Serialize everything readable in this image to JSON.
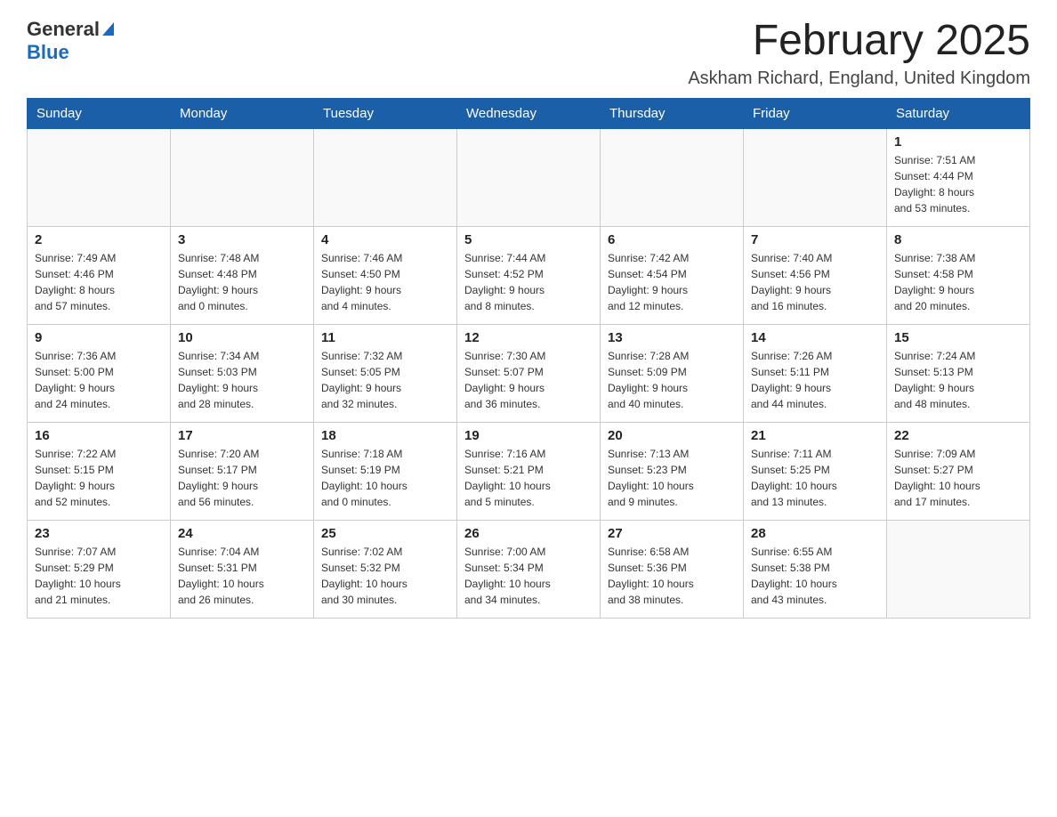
{
  "header": {
    "logo": {
      "text_general": "General",
      "text_blue": "Blue",
      "alt": "GeneralBlue Logo"
    },
    "title": "February 2025",
    "subtitle": "Askham Richard, England, United Kingdom"
  },
  "days_of_week": [
    "Sunday",
    "Monday",
    "Tuesday",
    "Wednesday",
    "Thursday",
    "Friday",
    "Saturday"
  ],
  "weeks": [
    [
      {
        "day": "",
        "info": ""
      },
      {
        "day": "",
        "info": ""
      },
      {
        "day": "",
        "info": ""
      },
      {
        "day": "",
        "info": ""
      },
      {
        "day": "",
        "info": ""
      },
      {
        "day": "",
        "info": ""
      },
      {
        "day": "1",
        "info": "Sunrise: 7:51 AM\nSunset: 4:44 PM\nDaylight: 8 hours\nand 53 minutes."
      }
    ],
    [
      {
        "day": "2",
        "info": "Sunrise: 7:49 AM\nSunset: 4:46 PM\nDaylight: 8 hours\nand 57 minutes."
      },
      {
        "day": "3",
        "info": "Sunrise: 7:48 AM\nSunset: 4:48 PM\nDaylight: 9 hours\nand 0 minutes."
      },
      {
        "day": "4",
        "info": "Sunrise: 7:46 AM\nSunset: 4:50 PM\nDaylight: 9 hours\nand 4 minutes."
      },
      {
        "day": "5",
        "info": "Sunrise: 7:44 AM\nSunset: 4:52 PM\nDaylight: 9 hours\nand 8 minutes."
      },
      {
        "day": "6",
        "info": "Sunrise: 7:42 AM\nSunset: 4:54 PM\nDaylight: 9 hours\nand 12 minutes."
      },
      {
        "day": "7",
        "info": "Sunrise: 7:40 AM\nSunset: 4:56 PM\nDaylight: 9 hours\nand 16 minutes."
      },
      {
        "day": "8",
        "info": "Sunrise: 7:38 AM\nSunset: 4:58 PM\nDaylight: 9 hours\nand 20 minutes."
      }
    ],
    [
      {
        "day": "9",
        "info": "Sunrise: 7:36 AM\nSunset: 5:00 PM\nDaylight: 9 hours\nand 24 minutes."
      },
      {
        "day": "10",
        "info": "Sunrise: 7:34 AM\nSunset: 5:03 PM\nDaylight: 9 hours\nand 28 minutes."
      },
      {
        "day": "11",
        "info": "Sunrise: 7:32 AM\nSunset: 5:05 PM\nDaylight: 9 hours\nand 32 minutes."
      },
      {
        "day": "12",
        "info": "Sunrise: 7:30 AM\nSunset: 5:07 PM\nDaylight: 9 hours\nand 36 minutes."
      },
      {
        "day": "13",
        "info": "Sunrise: 7:28 AM\nSunset: 5:09 PM\nDaylight: 9 hours\nand 40 minutes."
      },
      {
        "day": "14",
        "info": "Sunrise: 7:26 AM\nSunset: 5:11 PM\nDaylight: 9 hours\nand 44 minutes."
      },
      {
        "day": "15",
        "info": "Sunrise: 7:24 AM\nSunset: 5:13 PM\nDaylight: 9 hours\nand 48 minutes."
      }
    ],
    [
      {
        "day": "16",
        "info": "Sunrise: 7:22 AM\nSunset: 5:15 PM\nDaylight: 9 hours\nand 52 minutes."
      },
      {
        "day": "17",
        "info": "Sunrise: 7:20 AM\nSunset: 5:17 PM\nDaylight: 9 hours\nand 56 minutes."
      },
      {
        "day": "18",
        "info": "Sunrise: 7:18 AM\nSunset: 5:19 PM\nDaylight: 10 hours\nand 0 minutes."
      },
      {
        "day": "19",
        "info": "Sunrise: 7:16 AM\nSunset: 5:21 PM\nDaylight: 10 hours\nand 5 minutes."
      },
      {
        "day": "20",
        "info": "Sunrise: 7:13 AM\nSunset: 5:23 PM\nDaylight: 10 hours\nand 9 minutes."
      },
      {
        "day": "21",
        "info": "Sunrise: 7:11 AM\nSunset: 5:25 PM\nDaylight: 10 hours\nand 13 minutes."
      },
      {
        "day": "22",
        "info": "Sunrise: 7:09 AM\nSunset: 5:27 PM\nDaylight: 10 hours\nand 17 minutes."
      }
    ],
    [
      {
        "day": "23",
        "info": "Sunrise: 7:07 AM\nSunset: 5:29 PM\nDaylight: 10 hours\nand 21 minutes."
      },
      {
        "day": "24",
        "info": "Sunrise: 7:04 AM\nSunset: 5:31 PM\nDaylight: 10 hours\nand 26 minutes."
      },
      {
        "day": "25",
        "info": "Sunrise: 7:02 AM\nSunset: 5:32 PM\nDaylight: 10 hours\nand 30 minutes."
      },
      {
        "day": "26",
        "info": "Sunrise: 7:00 AM\nSunset: 5:34 PM\nDaylight: 10 hours\nand 34 minutes."
      },
      {
        "day": "27",
        "info": "Sunrise: 6:58 AM\nSunset: 5:36 PM\nDaylight: 10 hours\nand 38 minutes."
      },
      {
        "day": "28",
        "info": "Sunrise: 6:55 AM\nSunset: 5:38 PM\nDaylight: 10 hours\nand 43 minutes."
      },
      {
        "day": "",
        "info": ""
      }
    ]
  ]
}
